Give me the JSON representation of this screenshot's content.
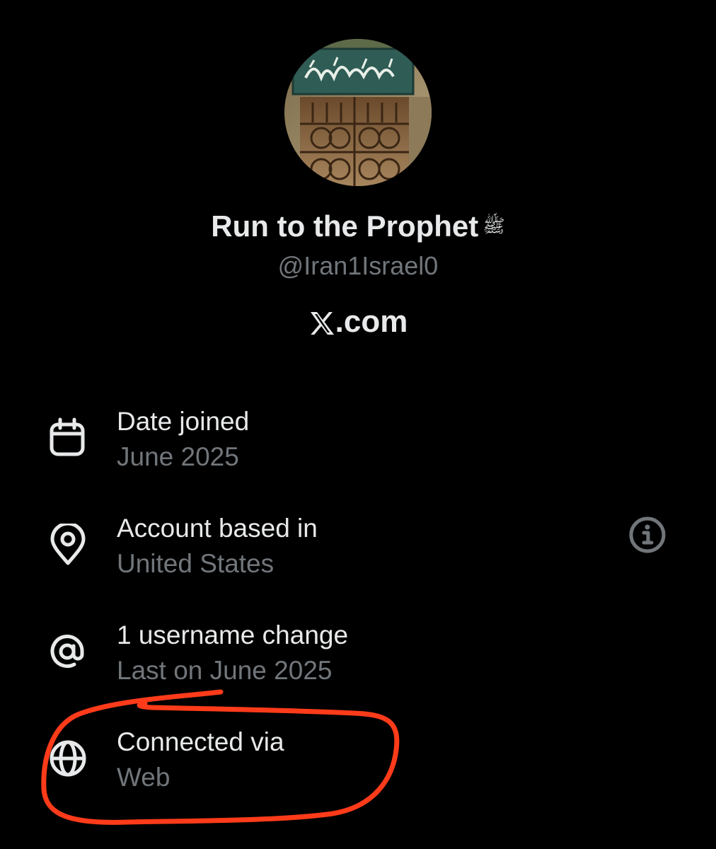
{
  "profile": {
    "display_name": "Run to the Prophet",
    "honorific": "ﷺ",
    "handle": "@Iran1Israel0",
    "site": ".com",
    "avatar_inscription": "كل نفس ذائقة الموت"
  },
  "details": [
    {
      "icon": "calendar-icon",
      "title": "Date joined",
      "subtitle": "June 2025"
    },
    {
      "icon": "location-pin-icon",
      "title": "Account based in",
      "subtitle": "United States",
      "has_info": true
    },
    {
      "icon": "at-sign-icon",
      "title": "1 username change",
      "subtitle": "Last on June 2025"
    },
    {
      "icon": "globe-icon",
      "title": "Connected via",
      "subtitle": "Web"
    }
  ],
  "colors": {
    "background": "#000000",
    "primary_text": "#e7e9ea",
    "secondary_text": "#71767b",
    "annotation": "#ff3b1a"
  }
}
